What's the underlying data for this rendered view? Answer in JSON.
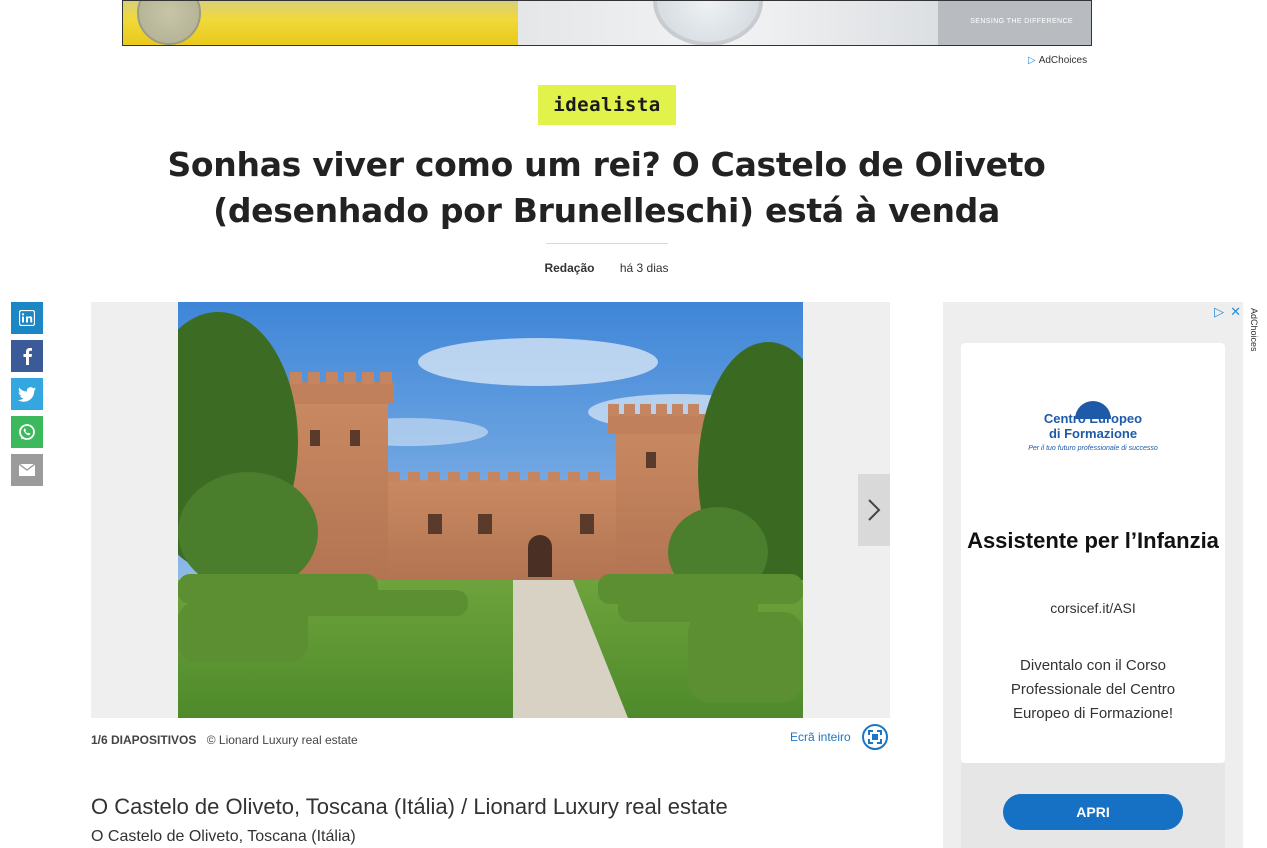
{
  "top_ad": {
    "tagline": "SENSING THE DIFFERENCE",
    "adchoices_label": "AdChoices"
  },
  "brand": {
    "name": "idealista"
  },
  "article": {
    "headline": "Sonhas viver como um rei? O Castelo de Oliveto (desenhado por Brunelleschi) está à venda",
    "author": "Redação",
    "published": "há 3 dias"
  },
  "share": {
    "linkedin": "in",
    "facebook": "f",
    "twitter": "t",
    "whatsapp": "w",
    "email": "e"
  },
  "slideshow": {
    "counter": "1/6 DIAPOSITIVOS",
    "credit": "© Lionard Luxury real estate",
    "fullscreen_label": "Ecrã inteiro",
    "next_icon": "chevron-right",
    "caption_title": "O Castelo de Oliveto, Toscana (Itália) / Lionard Luxury real estate",
    "caption_subtitle": "O Castelo de Oliveto, Toscana (Itália)"
  },
  "side_ad": {
    "adchoices_label": "AdChoices",
    "logo_line1": "Centro Europeo",
    "logo_line2": "di Formazione",
    "logo_slogan": "Per il tuo futuro professionale di successo",
    "headline": "Assistente per l’Infanzia",
    "url": "corsicef.it/ASI",
    "body": "Diventalo con il Corso Professionale del Centro Europeo di Formazione!",
    "cta": "APRI"
  },
  "colors": {
    "brand_badge": "#e1f24a",
    "link_blue": "#1d75c6",
    "linkedin": "#1d87c5",
    "facebook": "#3b5b98",
    "twitter": "#35a7e0",
    "whatsapp": "#3cb85d",
    "email": "#9b9b9b",
    "cta_blue": "#1670c4"
  }
}
